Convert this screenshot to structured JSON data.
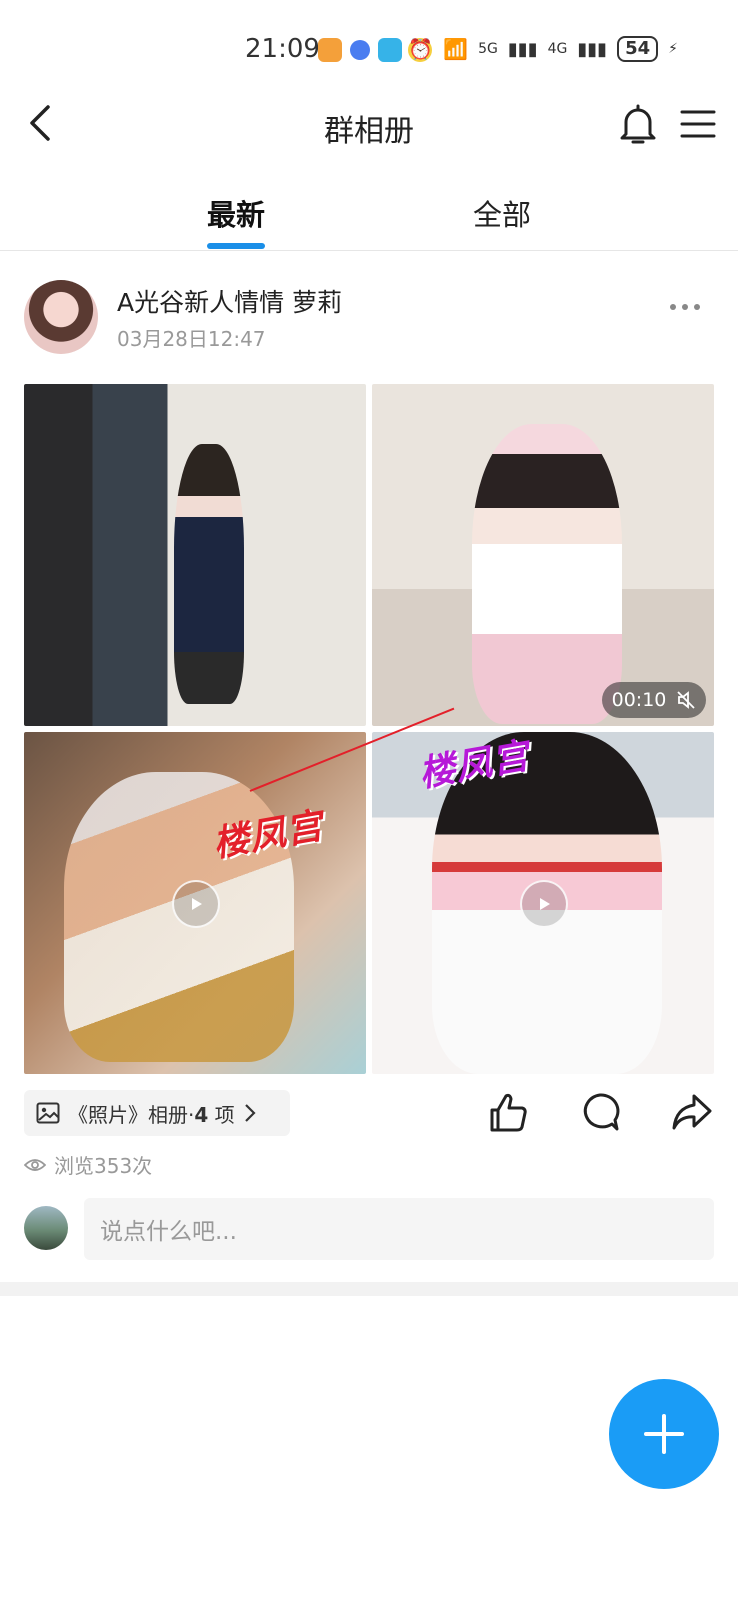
{
  "status_bar": {
    "time": "21:09",
    "network_5g": "5G",
    "network_4g": "4G",
    "battery": "54"
  },
  "header": {
    "title": "群相册",
    "back_icon": "chevron-left-icon",
    "bell_icon": "bell-icon",
    "menu_icon": "hamburger-menu-icon"
  },
  "tabs": [
    {
      "label": "最新",
      "active": true
    },
    {
      "label": "全部",
      "active": false
    }
  ],
  "post": {
    "author": "A光谷新人情情 萝莉",
    "time": "03月28日12:47",
    "video_duration": "00:10",
    "watermark": "楼凤宫",
    "album_label_prefix": "《照片》相册·",
    "album_count": "4",
    "album_unit": " 项",
    "views": "浏览353次"
  },
  "comment": {
    "placeholder": "说点什么吧..."
  },
  "colors": {
    "accent": "#1a8fe8",
    "fab": "#1a9cf6"
  }
}
